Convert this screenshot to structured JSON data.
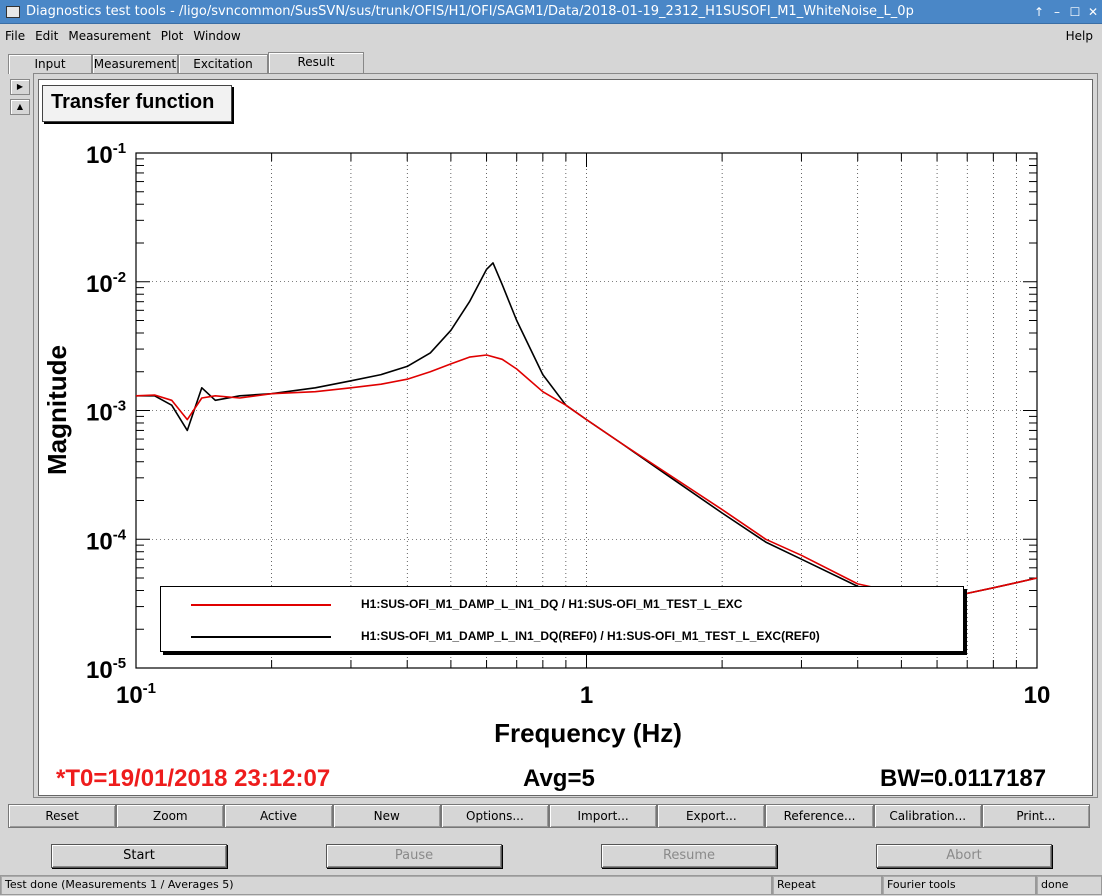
{
  "window": {
    "title": "Diagnostics test tools - /ligo/svncommon/SusSVN/sus/trunk/OFIS/H1/OFI/SAGM1/Data/2018-01-19_2312_H1SUSOFI_M1_WhiteNoise_L_0p"
  },
  "menu": {
    "file": "File",
    "edit": "Edit",
    "measurement": "Measurement",
    "plot": "Plot",
    "window": "Window",
    "help": "Help"
  },
  "tabs": [
    "Input",
    "Measurement",
    "Excitation",
    "Result"
  ],
  "plot_title": "Transfer function",
  "chart_data": {
    "type": "line",
    "title": "Transfer function",
    "xlabel": "Frequency (Hz)",
    "ylabel": "Magnitude",
    "xscale": "log",
    "yscale": "log",
    "xlim": [
      0.1,
      10
    ],
    "ylim": [
      1e-05,
      0.1
    ],
    "xticks": [
      {
        "base": "10",
        "exp": "-1"
      },
      {
        "base": "1",
        "exp": ""
      },
      {
        "base": "10",
        "exp": ""
      }
    ],
    "yticks": [
      {
        "base": "10",
        "exp": "-1"
      },
      {
        "base": "10",
        "exp": "-2"
      },
      {
        "base": "10",
        "exp": "-3"
      },
      {
        "base": "10",
        "exp": "-4"
      },
      {
        "base": "10",
        "exp": "-5"
      }
    ],
    "grid": true,
    "legend_position": "bottom",
    "series": [
      {
        "name": "H1:SUS-OFI_M1_DAMP_L_IN1_DQ / H1:SUS-OFI_M1_TEST_L_EXC",
        "color": "#e00000",
        "x": [
          0.1,
          0.11,
          0.12,
          0.13,
          0.14,
          0.15,
          0.17,
          0.2,
          0.25,
          0.3,
          0.35,
          0.4,
          0.45,
          0.5,
          0.55,
          0.6,
          0.65,
          0.7,
          0.8,
          0.9,
          1.0,
          1.2,
          1.5,
          2.0,
          2.5,
          3.0,
          4.0,
          5.0,
          6.0,
          7.0,
          8.0,
          9.0,
          10.0
        ],
        "y": [
          0.0013,
          0.00132,
          0.0012,
          0.00085,
          0.00125,
          0.0013,
          0.00125,
          0.00135,
          0.0014,
          0.0015,
          0.0016,
          0.00175,
          0.002,
          0.0023,
          0.0026,
          0.0027,
          0.0025,
          0.0021,
          0.0014,
          0.0011,
          0.00085,
          0.00055,
          0.00033,
          0.00017,
          0.0001,
          7.5e-05,
          4.5e-05,
          3.8e-05,
          3.6e-05,
          3.8e-05,
          4.2e-05,
          4.6e-05,
          5e-05
        ]
      },
      {
        "name": "H1:SUS-OFI_M1_DAMP_L_IN1_DQ(REF0) / H1:SUS-OFI_M1_TEST_L_EXC(REF0)",
        "color": "#000000",
        "x": [
          0.1,
          0.11,
          0.12,
          0.13,
          0.14,
          0.15,
          0.17,
          0.2,
          0.25,
          0.3,
          0.35,
          0.4,
          0.45,
          0.5,
          0.55,
          0.6,
          0.62,
          0.65,
          0.7,
          0.8,
          0.9,
          1.0,
          1.2,
          1.5,
          2.0,
          2.5,
          3.0,
          4.0,
          5.0,
          6.0,
          7.0,
          8.0,
          9.0,
          10.0
        ],
        "y": [
          0.0013,
          0.0013,
          0.0011,
          0.0007,
          0.0015,
          0.0012,
          0.0013,
          0.00135,
          0.0015,
          0.0017,
          0.0019,
          0.0022,
          0.0028,
          0.0042,
          0.007,
          0.0125,
          0.014,
          0.0095,
          0.005,
          0.0019,
          0.0011,
          0.00085,
          0.00055,
          0.00032,
          0.00016,
          9.5e-05,
          7e-05,
          4.3e-05,
          3.7e-05,
          3.6e-05,
          3.8e-05,
          4.2e-05,
          4.6e-05,
          5e-05
        ]
      }
    ]
  },
  "status": {
    "t0": "*T0=19/01/2018 23:12:07",
    "avg": "Avg=5",
    "bw": "BW=0.0117187"
  },
  "toolbar": [
    "Reset",
    "Zoom",
    "Active",
    "New",
    "Options...",
    "Import...",
    "Export...",
    "Reference...",
    "Calibration...",
    "Print..."
  ],
  "run_buttons": {
    "start": "Start",
    "pause": "Pause",
    "resume": "Resume",
    "abort": "Abort"
  },
  "statusbar": {
    "message": "Test done (Measurements 1 / Averages 5)",
    "repeat": "Repeat",
    "tools": "Fourier tools",
    "state": "done"
  }
}
